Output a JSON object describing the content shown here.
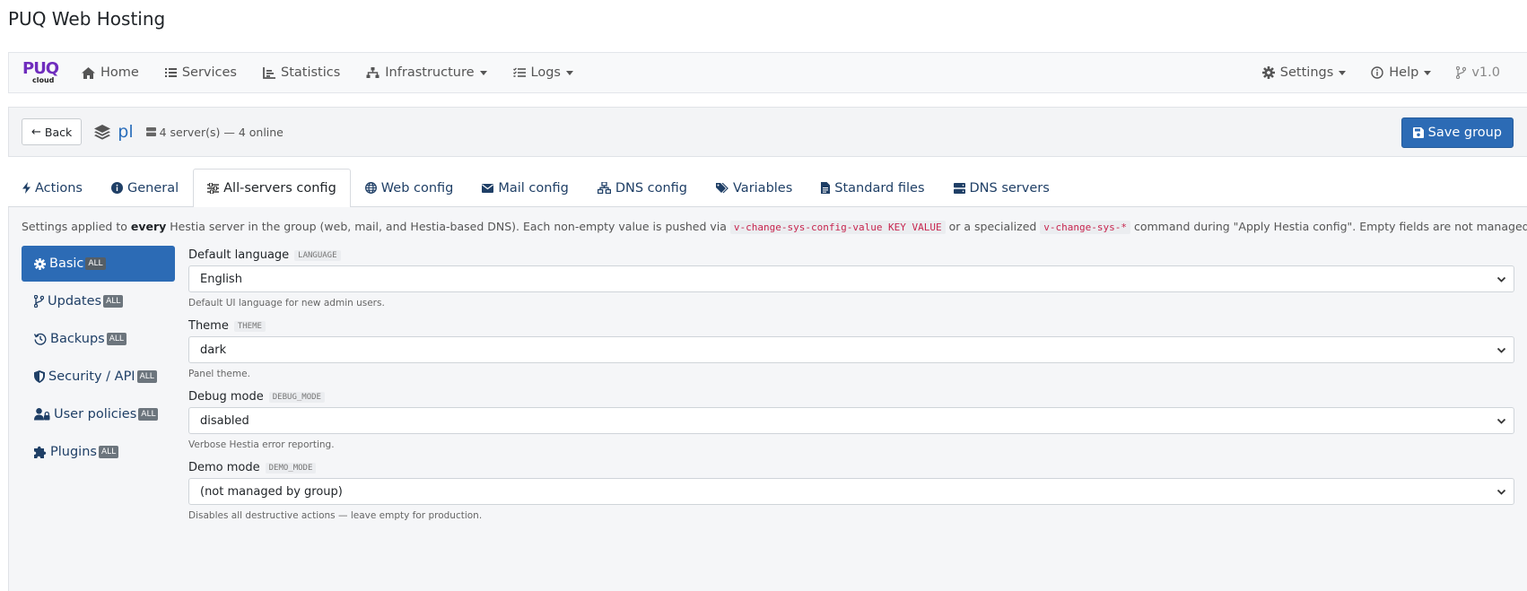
{
  "app": {
    "title": "PUQ Web Hosting",
    "logo_top": "PUQ",
    "logo_bottom": "cloud"
  },
  "nav": {
    "items": [
      {
        "label": "Home",
        "icon": "home-icon"
      },
      {
        "label": "Services",
        "icon": "list-icon"
      },
      {
        "label": "Statistics",
        "icon": "chart-icon"
      },
      {
        "label": "Infrastructure",
        "icon": "sitemap-icon"
      },
      {
        "label": "Logs",
        "icon": "list-check-icon"
      }
    ],
    "right": [
      {
        "label": "Settings",
        "icon": "gear-icon"
      },
      {
        "label": "Help",
        "icon": "info-circle-icon"
      },
      {
        "label": "v1.0",
        "icon": "code-branch-icon"
      }
    ]
  },
  "group": {
    "back_label": "Back",
    "name": "pl",
    "servers": "4 server(s) — 4 online",
    "save_label": "Save group"
  },
  "tabs": [
    {
      "label": "Actions",
      "icon": "bolt-icon"
    },
    {
      "label": "General",
      "icon": "info-icon"
    },
    {
      "label": "All-servers config",
      "icon": "sliders-icon",
      "active": true
    },
    {
      "label": "Web config",
      "icon": "globe-icon"
    },
    {
      "label": "Mail config",
      "icon": "envelope-icon"
    },
    {
      "label": "DNS config",
      "icon": "network-icon"
    },
    {
      "label": "Variables",
      "icon": "tags-icon"
    },
    {
      "label": "Standard files",
      "icon": "file-icon"
    },
    {
      "label": "DNS servers",
      "icon": "server-icon"
    }
  ],
  "intro": {
    "p1": "Settings applied to ",
    "bold": "every",
    "p2": " Hestia server in the group (web, mail, and Hestia-based DNS). Each non-empty value is pushed via ",
    "code1": "v-change-sys-config-value KEY VALUE",
    "p3": " or a specialized ",
    "code2": "v-change-sys-*",
    "p4": " command during \"Apply Hestia config\". Empty fields are not managed."
  },
  "sidebar": {
    "badge": "ALL",
    "items": [
      {
        "label": "Basic",
        "icon": "gear-icon",
        "active": true
      },
      {
        "label": "Updates",
        "icon": "code-branch-icon"
      },
      {
        "label": "Backups",
        "icon": "history-icon"
      },
      {
        "label": "Security / API",
        "icon": "shield-icon"
      },
      {
        "label": "User policies",
        "icon": "user-lock-icon"
      },
      {
        "label": "Plugins",
        "icon": "puzzle-icon"
      }
    ]
  },
  "fields": [
    {
      "label": "Default language",
      "key": "LANGUAGE",
      "value": "English",
      "help": "Default UI language for new admin users."
    },
    {
      "label": "Theme",
      "key": "THEME",
      "value": "dark",
      "help": "Panel theme."
    },
    {
      "label": "Debug mode",
      "key": "DEBUG_MODE",
      "value": "disabled",
      "help": "Verbose Hestia error reporting."
    },
    {
      "label": "Demo mode",
      "key": "DEMO_MODE",
      "value": "(not managed by group)",
      "help": "Disables all destructive actions — leave empty for production."
    }
  ]
}
